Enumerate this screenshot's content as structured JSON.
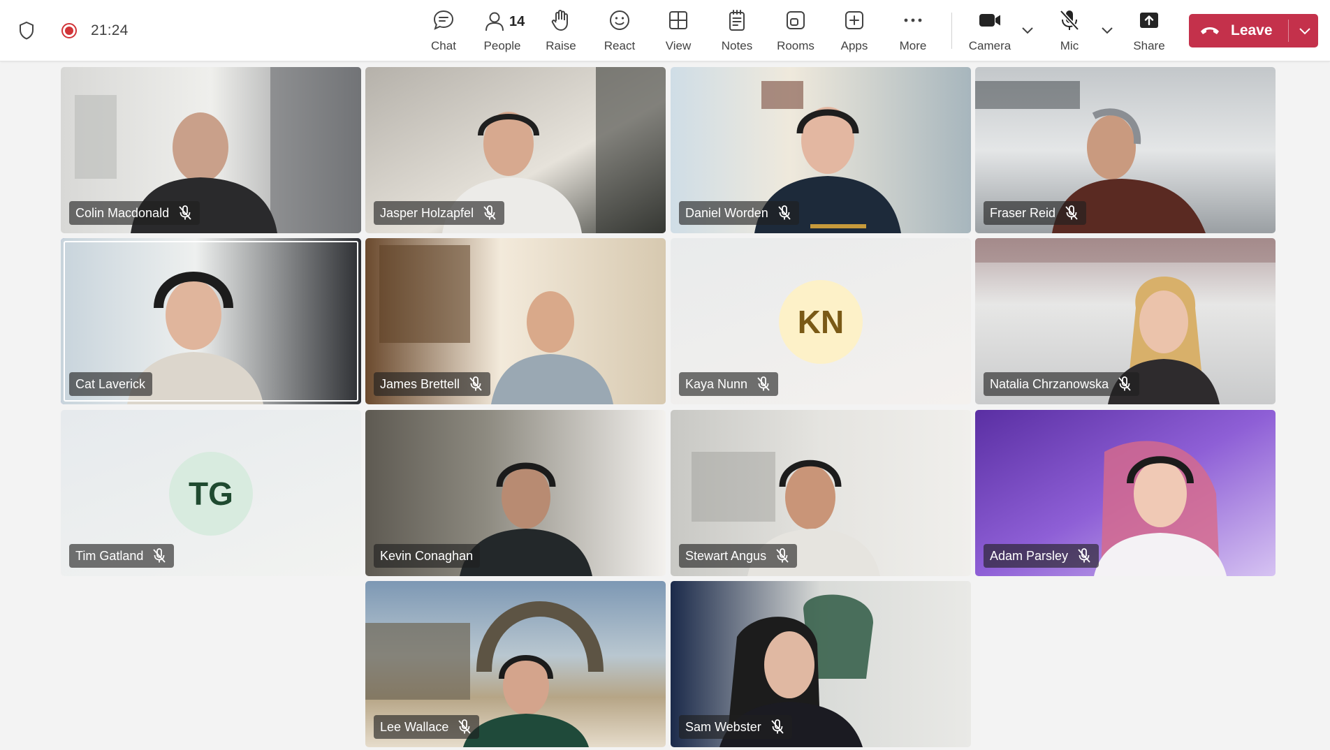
{
  "status": {
    "time": "21:24"
  },
  "toolbar": {
    "chat": "Chat",
    "people": "People",
    "people_count": "14",
    "raise": "Raise",
    "react": "React",
    "view": "View",
    "notes": "Notes",
    "rooms": "Rooms",
    "apps": "Apps",
    "more": "More",
    "camera": "Camera",
    "mic": "Mic",
    "share": "Share",
    "leave": "Leave"
  },
  "participants": [
    {
      "name": "Colin Macdonald",
      "muted": true
    },
    {
      "name": "Jasper Holzapfel",
      "muted": true
    },
    {
      "name": "Daniel Worden",
      "muted": true
    },
    {
      "name": "Fraser Reid",
      "muted": true
    },
    {
      "name": "Cat Laverick",
      "muted": false,
      "speaking": true
    },
    {
      "name": "James Brettell",
      "muted": true
    },
    {
      "name": "Kaya Nunn",
      "muted": true,
      "initials": "KN"
    },
    {
      "name": "Natalia Chrzanowska",
      "muted": true
    },
    {
      "name": "Tim Gatland",
      "muted": true,
      "initials": "TG"
    },
    {
      "name": "Kevin Conaghan",
      "muted": false
    },
    {
      "name": "Stewart Angus",
      "muted": true
    },
    {
      "name": "Adam Parsley",
      "muted": true
    },
    {
      "name": "Lee Wallace",
      "muted": true
    },
    {
      "name": "Sam Webster",
      "muted": true
    }
  ],
  "colors": {
    "leave": "#c4314b",
    "active_border": "#5b5fc7",
    "recording": "#d13438"
  }
}
